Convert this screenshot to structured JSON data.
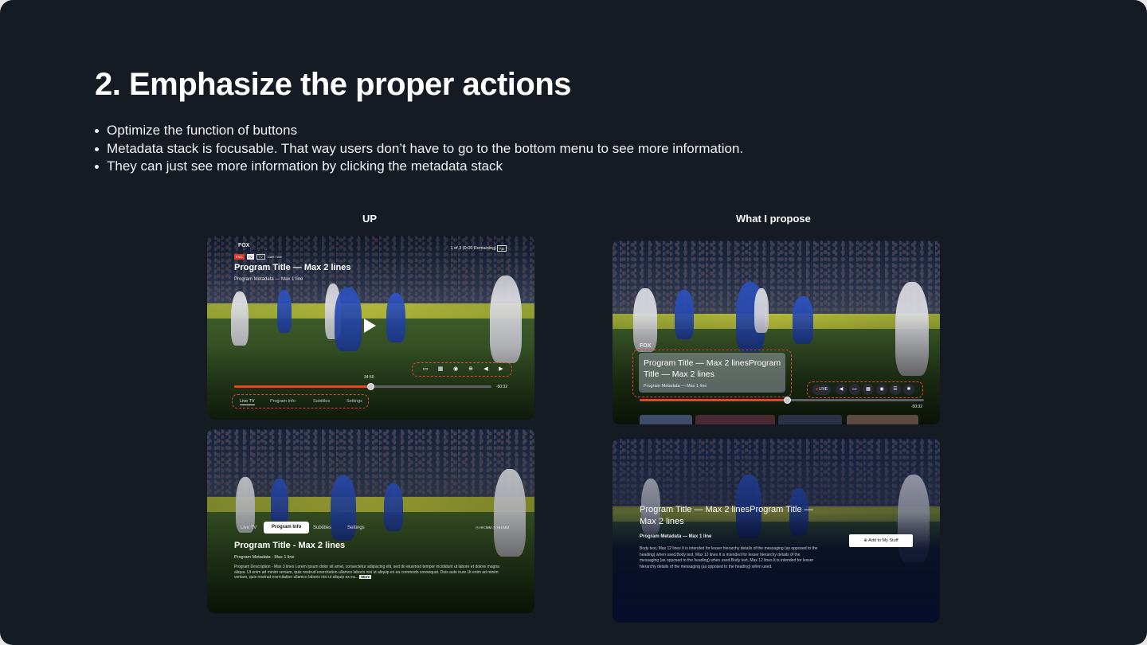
{
  "heading": {
    "title": "2. Emphasize the proper actions",
    "bullets": [
      "Optimize the function of buttons",
      "Metadata stack is focusable. That way users don’t have to go to the bottom menu to see more information.",
      "They can just see more information by clicking the metadata stack"
    ]
  },
  "columns": {
    "left": "UP",
    "right": "What I propose"
  },
  "up_player": {
    "logo": "FOX",
    "badges": [
      "ENG",
      "TV",
      "TV"
    ],
    "badge_text": "Date Time",
    "ad_counter": "1 of 3 (0:00 Remaining)",
    "ad_badge": "AD",
    "title": "Program Title — Max 2 lines",
    "metadata": "Program Metadata — Max 1 line",
    "current_time": "34:50",
    "remaining": "-50:32",
    "progress": 0.53,
    "tabs": [
      "Live TV",
      "Program Info",
      "Subtitles",
      "Settings"
    ],
    "active_tab": "Live TV"
  },
  "up_info": {
    "tabs": [
      "Live TV",
      "Program Info",
      "Subtitles",
      "Settings"
    ],
    "active_tab": "Program Info",
    "right_meta": [
      "HH:MM",
      "HH:MM"
    ],
    "title": "Program Title - Max 2 lines",
    "metadata": "Program Metadata - Max 1 line",
    "description": "Program Description - Max 3 lines Lorem ipsum dolor sit amet, consectetur adipiscing elit, sed do eiusmod tempor incididunt ut labore et dolore magna aliqua. Ut enim ad minim veniam, quis nostrud exercitation ullamco laboris nisi ut aliquip ex ea commodo consequat. Duis aute irure Ut enim ad minim veniam, quis nostrud exercitation ullamco laboris nisi ut aliquip ex ea...",
    "more_label": "More"
  },
  "proposed_player": {
    "logo": "FOX",
    "title": "Program Title — Max 2 linesProgram Title — Max 2 lines",
    "metadata": "Program Metadata — Max 1 line",
    "live_label": "LIVE",
    "remaining": "-50:32",
    "progress": 0.52
  },
  "proposed_info": {
    "title": "Program Title — Max 2 linesProgram Title — Max 2 lines",
    "metadata": "Program Metadata — Max 1 line",
    "body": "Body text, Max 12 lines It is intended for lesser hierarchy details of the messaging (as opposed to the heading) when used.Body text, Max 12 lines It is intended for lesser hierarchy details of the messaging (as opposed to the heading) when used.Body text, Max 12 lines It is intended for lesser hierarchy details of the messaging (as opposed to the heading) when used.",
    "add_button": "Add to My Stuff"
  },
  "colors": {
    "accent": "#e8441f",
    "background": "#161a23",
    "dash": "#e0463a"
  }
}
